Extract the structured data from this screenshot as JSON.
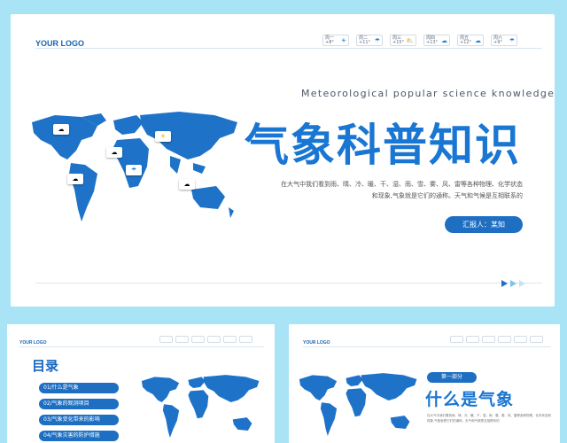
{
  "logo_text": "YOUR LOGO",
  "weather_cards": [
    {
      "day": "周一",
      "temp": "+8°",
      "icon": "sun-icon"
    },
    {
      "day": "周二",
      "temp": "+11°",
      "icon": "rain-icon"
    },
    {
      "day": "周三",
      "temp": "+15°",
      "icon": "sun-cloud-icon"
    },
    {
      "day": "周四",
      "temp": "+13°",
      "icon": "cloud-icon"
    },
    {
      "day": "周五",
      "temp": "+12°",
      "icon": "cloud-icon"
    },
    {
      "day": "周六",
      "temp": "+9°",
      "icon": "rain-icon"
    }
  ],
  "subtitle": "Meteorological popular science knowledge",
  "title": "气象科普知识",
  "description": "在大气中我们看到雨、晴、冷、暖、干、湿、雨、雪、雾、风、雷等各种物理、化学状态和现象,气象就是它们的通称。天气和气候是互相联系的",
  "reporter_label": "汇报人：某知",
  "toc": {
    "title": "目录",
    "items": [
      "01/什么是气象",
      "02/气象的观测项目",
      "03/气象变化带来的影响",
      "04/气象灾害的防护措施"
    ]
  },
  "section": {
    "badge": "第一部分",
    "title": "什么是气象",
    "description": "在大气中我们看到雨、晴、冷、暖、干、湿、雨、雪、雾、风、雷等各种物理、化学状态和现象,气象就是它们的通称。天气和气候是互相联系的"
  },
  "colors": {
    "primary": "#1976d2",
    "map": "#1e73c8",
    "background": "#a9e3f6"
  }
}
